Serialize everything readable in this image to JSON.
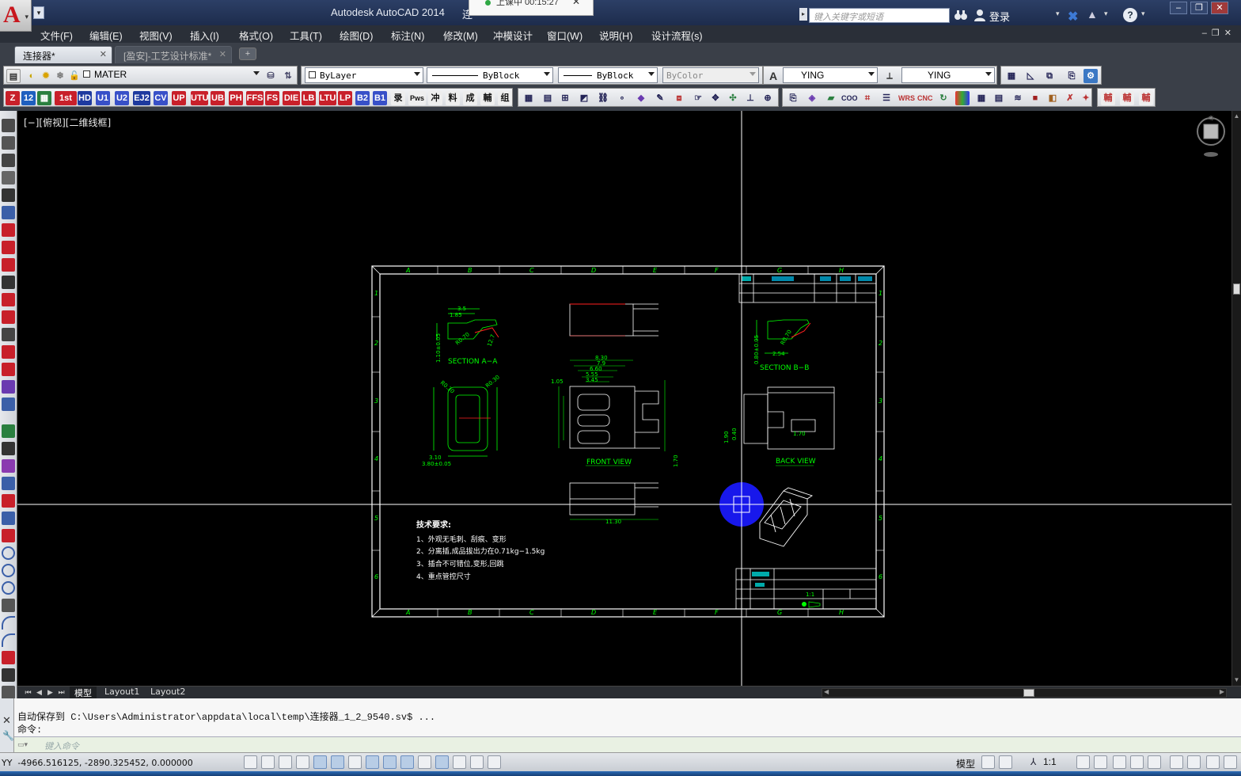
{
  "window": {
    "app_title": "Autodesk AutoCAD 2014",
    "doc_title_partial": "连",
    "timer_text": "上课中 00:15:27",
    "search_placeholder": "键入关键字或短语",
    "login_label": "登录"
  },
  "menu": [
    "文件(F)",
    "编辑(E)",
    "视图(V)",
    "插入(I)",
    "格式(O)",
    "工具(T)",
    "绘图(D)",
    "标注(N)",
    "修改(M)",
    "冲模设计",
    "窗口(W)",
    "说明(H)",
    "设计流程(s)"
  ],
  "tabs": {
    "active": "连接器*",
    "inactive": "[盈安]-工艺设计标准*"
  },
  "toolbar": {
    "layer": "MATER",
    "color": "ByLayer",
    "linetype": "ByBlock",
    "lineweight": "ByBlock",
    "plotstyle": "ByColor",
    "textstyle": "YING",
    "dimstyle": "YING",
    "text_icons": [
      "HD",
      "U1",
      "U2",
      "EJ2",
      "CV",
      "UP",
      "UTU",
      "UB",
      "PH",
      "FFS",
      "FS",
      "DIE",
      "LB",
      "LTU",
      "LP",
      "B2",
      "B1",
      "录",
      "Pws",
      "冲",
      "料",
      "成",
      "輔",
      "组"
    ]
  },
  "viewport_label": "[−][俯视][二维线框]",
  "drawing": {
    "border_letters": [
      "A",
      "B",
      "C",
      "D",
      "E",
      "F",
      "G",
      "H"
    ],
    "border_numbers": [
      "1",
      "2",
      "3",
      "4",
      "5",
      "6"
    ],
    "section_aa": "SECTION  A−A",
    "section_bb": "SECTION  B−B",
    "front_view": "FRONT  VIEW",
    "back_view": "BACK  VIEW",
    "tech_title": "技术要求:",
    "tech_items": [
      "1、外观无毛刺、刮痕、变形",
      "2、分离插,成品拔出力在0.71kg−1.5kg",
      "3、插合不可错位,变形,回跳",
      "4、重点管控尺寸"
    ],
    "dims_aa": [
      "3.5",
      "1.85",
      "R0.70",
      "12.7",
      "1.10±0.05"
    ],
    "dims_front": [
      "8.30",
      "7.9",
      "6.60",
      "5.55",
      "3.45",
      "1.05",
      "11.30",
      "1.70"
    ],
    "dims_left": [
      "R0.30",
      "R0.30",
      "3.10",
      "3.80±0.05"
    ],
    "dims_back": [
      "1.90",
      "0.40",
      "1.70"
    ],
    "dims_bb": [
      "0.80±0.05",
      "2.54",
      "R0.70"
    ],
    "title_block_scale": "1:1"
  },
  "layout_tabs": [
    "模型",
    "Layout1",
    "Layout2"
  ],
  "command": {
    "history": [
      "自动保存到 C:\\Users\\Administrator\\appdata\\local\\temp\\连接器_1_2_9540.sv$ ...",
      "命令:"
    ],
    "input_placeholder": "键入命令"
  },
  "status": {
    "coords": "YY  -4966.516125, -2890.325452, 0.000000",
    "model": "模型",
    "scale": "1:1"
  },
  "colors": {
    "drawing_green": "#00ff00",
    "crosshair": "#ffffff",
    "cursor_blue": "#1a1aff"
  }
}
